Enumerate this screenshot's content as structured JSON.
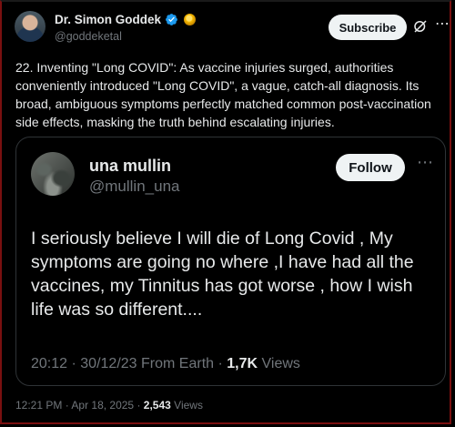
{
  "post": {
    "author_name": "Dr. Simon Goddek",
    "author_handle": "@goddeketal",
    "subscribe_label": "Subscribe",
    "text": "22. Inventing \"Long COVID\": As vaccine injuries surged, authorities conveniently introduced \"Long COVID\", a vague, catch-all diagnosis. Its broad, ambiguous symptoms perfectly matched common post-vaccination side effects, masking the truth behind escalating injuries.",
    "time": "12:21 PM",
    "date": "Apr 18, 2025",
    "views_count": "2,543",
    "views_label": "Views"
  },
  "quote": {
    "author_name": "una mullin",
    "author_handle": "@mullin_una",
    "follow_label": "Follow",
    "text": "I seriously believe I will die of Long Covid , My symptoms are going no where ,I have had all the vaccines, my Tinnitus has got worse , how I wish life was so different....",
    "time": "20:12",
    "date": "30/12/23",
    "source": "From Earth",
    "views_count": "1,7K",
    "views_label": "Views"
  },
  "colors": {
    "background": "#000000",
    "text_primary": "#e7e9ea",
    "text_secondary": "#71767b",
    "button_bg": "#eff3f4",
    "verified_blue": "#1d9bf0",
    "border": "#2f3336"
  },
  "icons": {
    "verified": "verified-badge-icon",
    "affiliate": "gold-badge-icon",
    "grok": "grok-icon",
    "more": "more-options-icon"
  }
}
